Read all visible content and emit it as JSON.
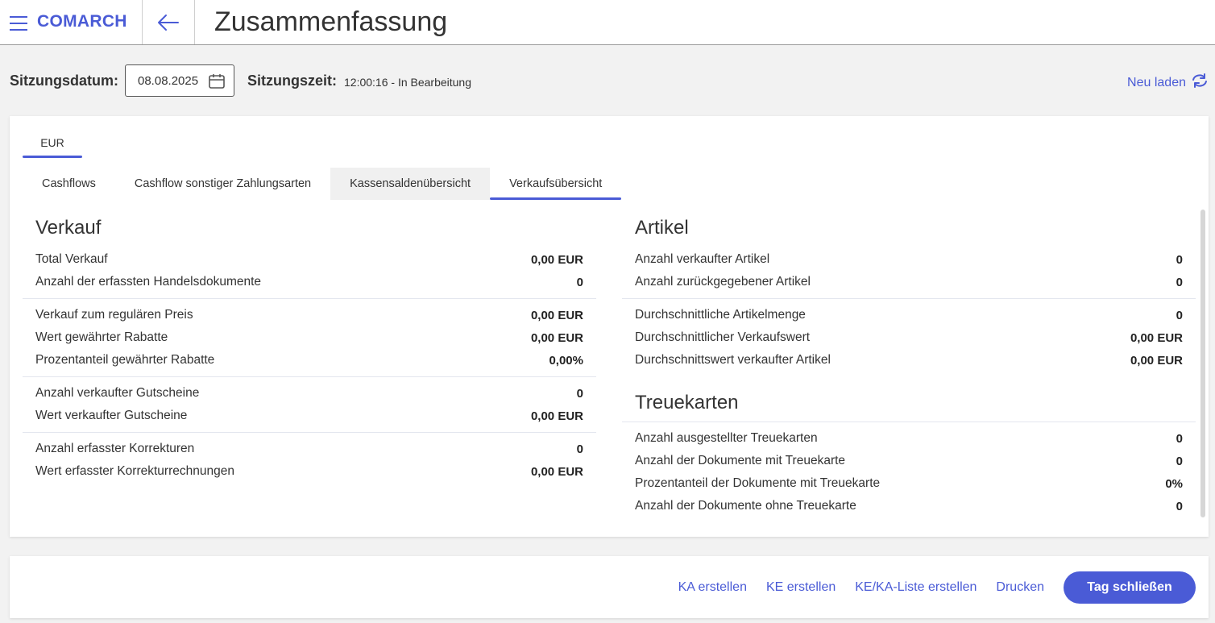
{
  "header": {
    "logo": "COMARCH",
    "title": "Zusammenfassung"
  },
  "session": {
    "date_label": "Sitzungsdatum:",
    "date_value": "08.08.2025",
    "time_label": "Sitzungszeit:",
    "time_value": "12:00:16 - In Bearbeitung",
    "reload_label": "Neu laden"
  },
  "currency_tab": "EUR",
  "tabs": [
    {
      "label": "Cashflows"
    },
    {
      "label": "Cashflow sonstiger Zahlungsarten"
    },
    {
      "label": "Kassensaldenübersicht"
    },
    {
      "label": "Verkaufsübersicht"
    }
  ],
  "sales": {
    "title": "Verkauf",
    "groups": [
      [
        {
          "label": "Total Verkauf",
          "value": "0,00 EUR"
        },
        {
          "label": "Anzahl der erfassten Handelsdokumente",
          "value": "0"
        }
      ],
      [
        {
          "label": "Verkauf zum regulären Preis",
          "value": "0,00 EUR"
        },
        {
          "label": "Wert gewährter Rabatte",
          "value": "0,00 EUR"
        },
        {
          "label": "Prozentanteil gewährter Rabatte",
          "value": "0,00%"
        }
      ],
      [
        {
          "label": "Anzahl verkaufter Gutscheine",
          "value": "0"
        },
        {
          "label": "Wert verkaufter Gutscheine",
          "value": "0,00 EUR"
        }
      ],
      [
        {
          "label": "Anzahl erfasster Korrekturen",
          "value": "0"
        },
        {
          "label": "Wert erfasster Korrekturrechnungen",
          "value": "0,00 EUR"
        }
      ]
    ]
  },
  "articles": {
    "title": "Artikel",
    "groups": [
      [
        {
          "label": "Anzahl verkaufter Artikel",
          "value": "0"
        },
        {
          "label": "Anzahl zurückgegebener Artikel",
          "value": "0"
        }
      ],
      [
        {
          "label": "Durchschnittliche Artikelmenge",
          "value": "0"
        },
        {
          "label": "Durchschnittlicher Verkaufswert",
          "value": "0,00 EUR"
        },
        {
          "label": "Durchschnittswert verkaufter Artikel",
          "value": "0,00 EUR"
        }
      ]
    ]
  },
  "loyalty": {
    "title": "Treuekarten",
    "rows": [
      {
        "label": "Anzahl ausgestellter Treuekarten",
        "value": "0"
      },
      {
        "label": "Anzahl der Dokumente mit Treuekarte",
        "value": "0"
      },
      {
        "label": "Prozentanteil der Dokumente mit Treuekarte",
        "value": "0%"
      },
      {
        "label": "Anzahl der Dokumente ohne Treuekarte",
        "value": "0"
      }
    ]
  },
  "footer": {
    "ka_label": "KA erstellen",
    "ke_label": "KE erstellen",
    "list_label": "KE/KA-Liste erstellen",
    "print_label": "Drucken",
    "close_day_label": "Tag schließen"
  },
  "colors": {
    "accent": "#4a5bd6",
    "background": "#f2f2f2"
  }
}
